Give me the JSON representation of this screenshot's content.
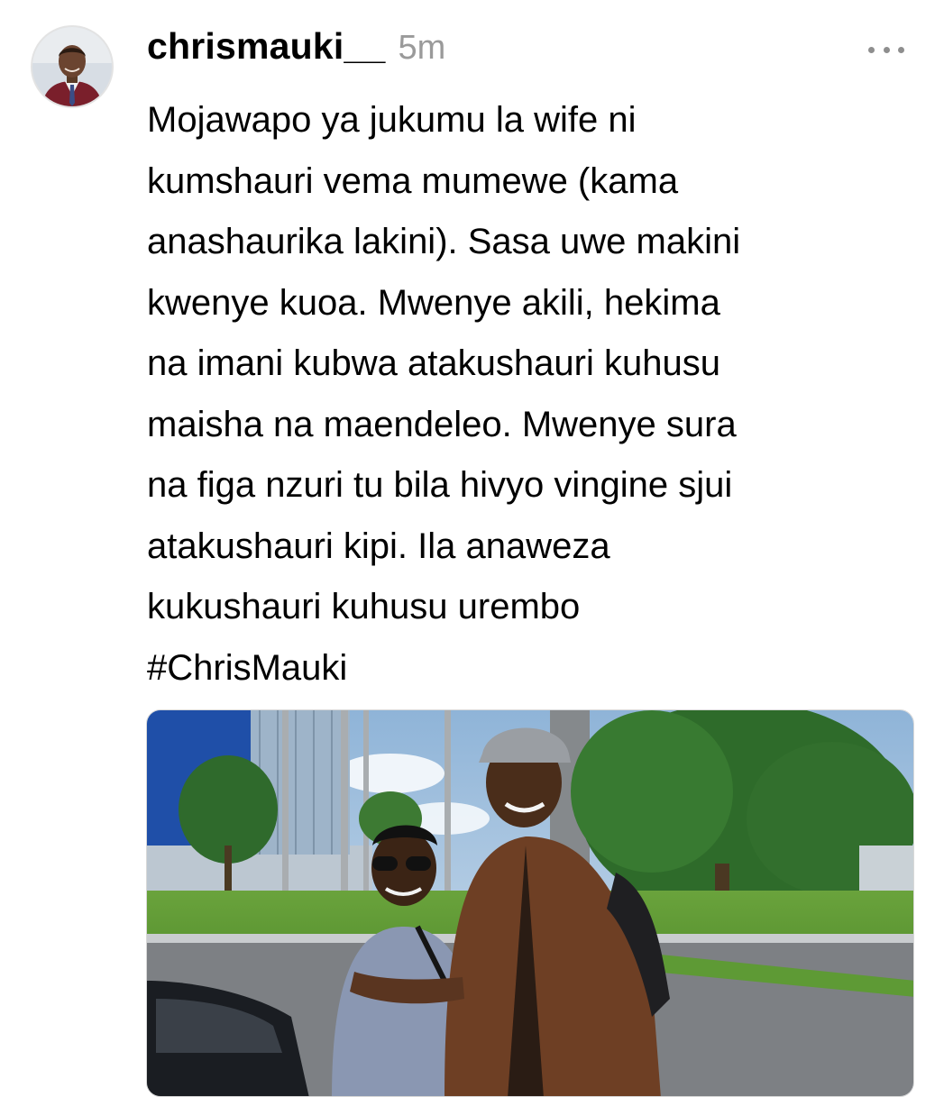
{
  "post": {
    "author": {
      "username": "chrismauki__",
      "avatar_icon": "avatar-photo"
    },
    "time_ago": "5m",
    "more_icon": "more-horizontal-icon",
    "body_text": "Mojawapo ya jukumu la wife ni\nkumshauri vema mumewe (kama\nanashaurika lakini). Sasa uwe makini\nkwenye kuoa. Mwenye akili, hekima\nna imani kubwa atakushauri kuhusu\nmaisha na maendeleo. Mwenye sura\nna figa nzuri tu bila hivyo vingine sjui\natakushauri kipi. Ila anaweza\nkukushauri kuhusu urembo",
    "hashtag": "#ChrisMauki",
    "attachment": {
      "type": "photo",
      "icon": "photo-couple-outdoors"
    }
  },
  "colors": {
    "text": "#000000",
    "muted": "#9a9a9a",
    "background": "#ffffff"
  }
}
